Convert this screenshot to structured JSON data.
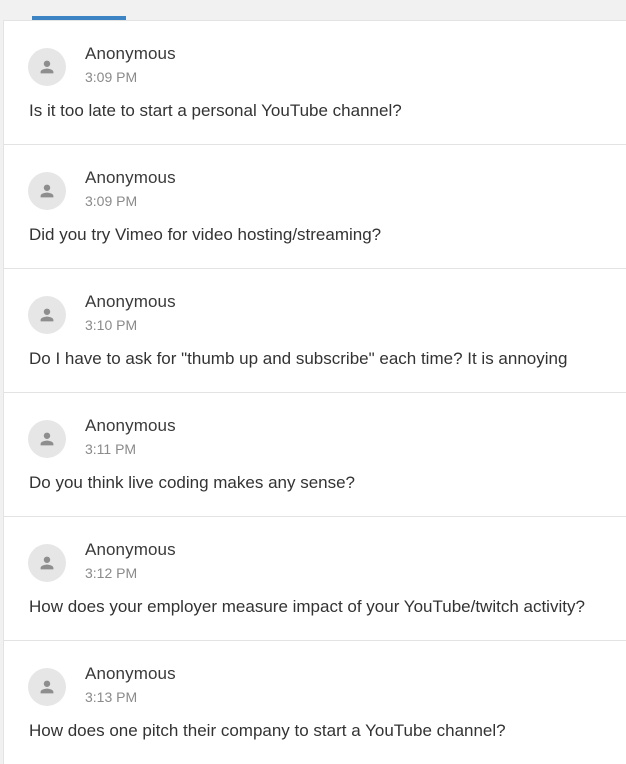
{
  "colors": {
    "tab_indicator": "#3c84c4",
    "avatar_bg": "#e6e6e6",
    "avatar_icon": "#8e8e8e"
  },
  "questions": [
    {
      "author": "Anonymous",
      "time": "3:09 PM",
      "text": "Is it too late to start a personal YouTube channel?",
      "icon": "person-icon"
    },
    {
      "author": "Anonymous",
      "time": "3:09 PM",
      "text": "Did you try Vimeo for video hosting/streaming?",
      "icon": "person-icon"
    },
    {
      "author": "Anonymous",
      "time": "3:10 PM",
      "text": "Do I have to ask for \"thumb up and subscribe\" each time? It is annoying",
      "icon": "person-icon"
    },
    {
      "author": "Anonymous",
      "time": "3:11 PM",
      "text": "Do you think live coding makes any sense?",
      "icon": "person-icon"
    },
    {
      "author": "Anonymous",
      "time": "3:12 PM",
      "text": "How does your employer measure impact of your YouTube/twitch activity?",
      "icon": "person-icon"
    },
    {
      "author": "Anonymous",
      "time": "3:13 PM",
      "text": "How does one pitch their company to start a YouTube channel?",
      "icon": "person-icon"
    }
  ]
}
